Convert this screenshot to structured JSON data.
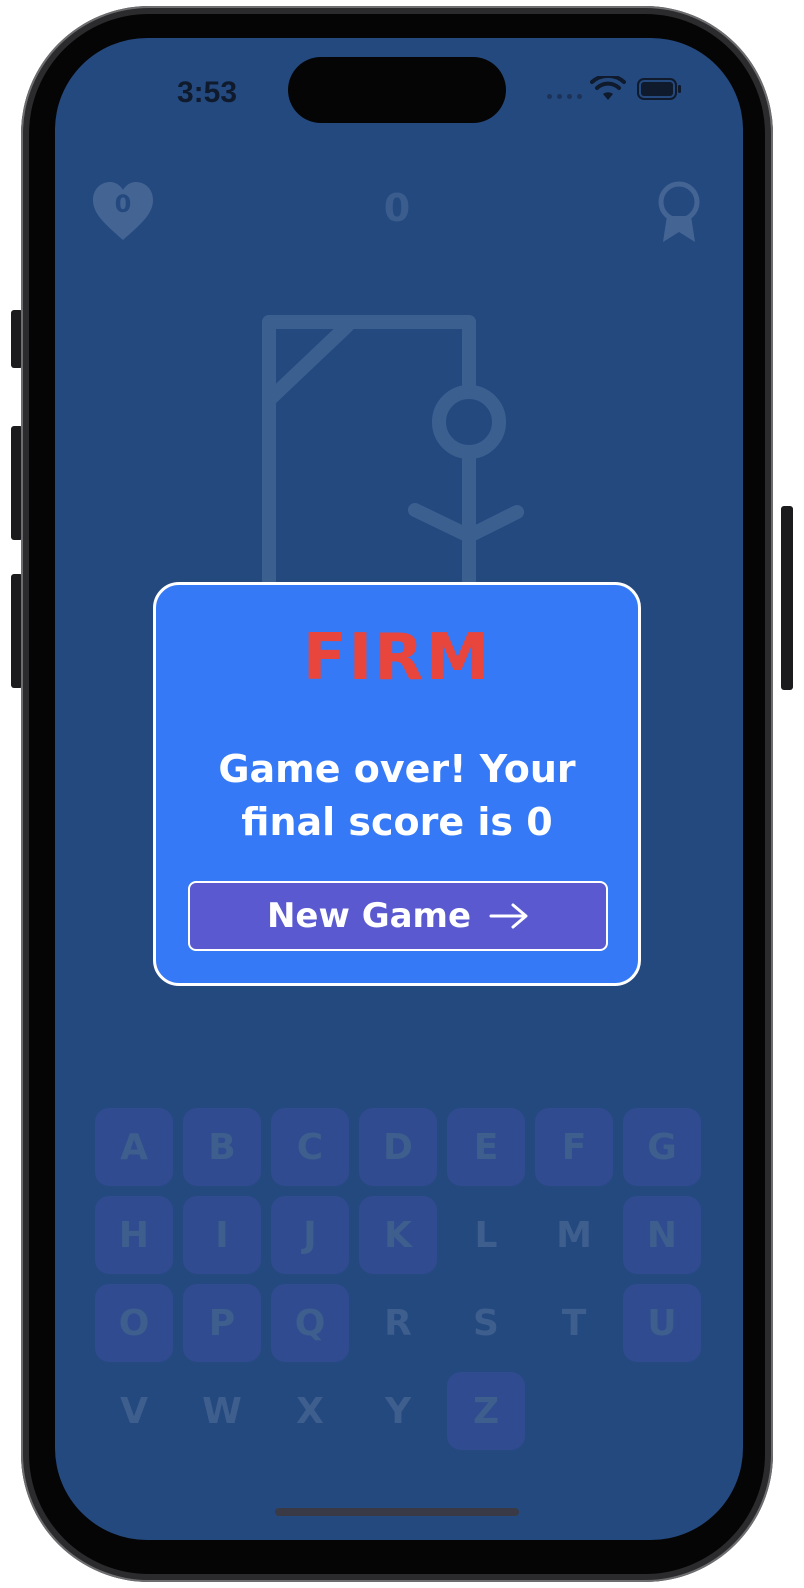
{
  "status_bar": {
    "time": "3:53",
    "icons": [
      "cellular-dots-icon",
      "wifi-icon",
      "battery-icon"
    ]
  },
  "game": {
    "lives": "0",
    "score": "0",
    "icons": [
      "heart-icon",
      "award-icon",
      "hangman-figure"
    ]
  },
  "modal": {
    "word": "FIRM",
    "message": "Game over! Your final score is 0",
    "button_label": "New Game",
    "button_icon": "arrow-right-icon"
  },
  "keyboard": {
    "keys": [
      {
        "letter": "A",
        "state": "active"
      },
      {
        "letter": "B",
        "state": "active"
      },
      {
        "letter": "C",
        "state": "active"
      },
      {
        "letter": "D",
        "state": "active"
      },
      {
        "letter": "E",
        "state": "active"
      },
      {
        "letter": "F",
        "state": "active"
      },
      {
        "letter": "G",
        "state": "active"
      },
      {
        "letter": "H",
        "state": "active"
      },
      {
        "letter": "I",
        "state": "active"
      },
      {
        "letter": "J",
        "state": "active"
      },
      {
        "letter": "K",
        "state": "active"
      },
      {
        "letter": "L",
        "state": "used"
      },
      {
        "letter": "M",
        "state": "used"
      },
      {
        "letter": "N",
        "state": "active"
      },
      {
        "letter": "O",
        "state": "active"
      },
      {
        "letter": "P",
        "state": "active"
      },
      {
        "letter": "Q",
        "state": "active"
      },
      {
        "letter": "R",
        "state": "used"
      },
      {
        "letter": "S",
        "state": "used"
      },
      {
        "letter": "T",
        "state": "used"
      },
      {
        "letter": "U",
        "state": "active"
      },
      {
        "letter": "V",
        "state": "used"
      },
      {
        "letter": "W",
        "state": "used"
      },
      {
        "letter": "X",
        "state": "used"
      },
      {
        "letter": "Y",
        "state": "used"
      },
      {
        "letter": "Z",
        "state": "active"
      }
    ]
  },
  "colors": {
    "background": "#24497f",
    "modal": "#3579f6",
    "word": "#e8453c",
    "button": "#5a59d0",
    "key_active": "#5a55c8"
  }
}
